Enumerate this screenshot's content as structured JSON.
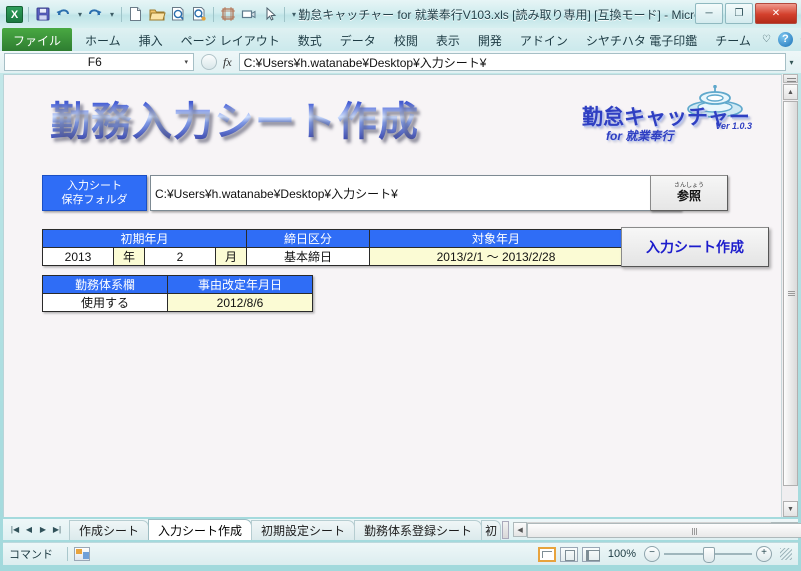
{
  "window": {
    "title": "勤怠キャッチャー for 就業奉行V103.xls [読み取り専用] [互換モード] - Micro...",
    "minimize": "─",
    "maximize": "❐",
    "close": "✕"
  },
  "quick_access": {
    "app_logo": "X",
    "items": [
      {
        "name": "save-icon",
        "label": "save"
      },
      {
        "name": "undo-icon",
        "label": "undo"
      },
      {
        "name": "undo-dropdown-icon",
        "label": "▾"
      },
      {
        "name": "redo-icon",
        "label": "redo"
      },
      {
        "name": "redo-dropdown-icon",
        "label": "▾"
      },
      {
        "name": "new-file-icon",
        "label": "new"
      },
      {
        "name": "open-folder-icon",
        "label": "open"
      },
      {
        "name": "print-preview-icon",
        "label": "print preview"
      },
      {
        "name": "quick-print-icon",
        "label": "quick print"
      },
      {
        "name": "page-setup-icon",
        "label": "page setup"
      },
      {
        "name": "camera-icon",
        "label": "camera"
      },
      {
        "name": "select-cursor-icon",
        "label": "select"
      },
      {
        "name": "customize-qat-icon",
        "label": "▾"
      }
    ]
  },
  "ribbon": {
    "tabs": [
      {
        "label": "ファイル",
        "active": true
      },
      {
        "label": "ホーム"
      },
      {
        "label": "挿入"
      },
      {
        "label": "ページ レイアウト"
      },
      {
        "label": "数式"
      },
      {
        "label": "データ"
      },
      {
        "label": "校閲"
      },
      {
        "label": "表示"
      },
      {
        "label": "開発"
      },
      {
        "label": "アドイン"
      },
      {
        "label": "シヤチハタ 電子印鑑"
      },
      {
        "label": "チーム"
      }
    ],
    "heart_icon": "♡",
    "help_icon": "?",
    "minimize_ribbon": "─",
    "restore_window": "❐",
    "close_window": "✕"
  },
  "formula_bar": {
    "name_box_value": "F6",
    "name_box_arrow": "▾",
    "fx_label": "fx",
    "formula_value": "C:¥Users¥h.watanabe¥Desktop¥入力シート¥",
    "expand_arrow": "▾"
  },
  "sheet": {
    "heading": "勤務入力シート作成",
    "logo": {
      "main": "勤怠キャッチャー",
      "sub": "for 就業奉行",
      "version": "Ver 1.0.3"
    },
    "folder": {
      "label_line1": "入力シート",
      "label_line2": "保存フォルダ",
      "path_value": "C:¥Users¥h.watanabe¥Desktop¥入力シート¥",
      "browse_button": "参照",
      "browse_button_ruby": "さんしょう"
    },
    "create_button": "入力シート作成",
    "table_period": {
      "headers": [
        "初期年月",
        "締日区分",
        "対象年月"
      ],
      "cells": {
        "year_value": "2013",
        "year_unit": "年",
        "month_value": "2",
        "month_unit": "月",
        "closing_type": "基本締日",
        "target_period": "2013/2/1  ～  2013/2/28"
      }
    },
    "table_system": {
      "headers": [
        "勤務体系欄",
        "事由改定年月日"
      ],
      "values": [
        "使用する",
        "2012/8/6"
      ]
    }
  },
  "sheet_tabs": {
    "nav": [
      "|◀",
      "◀",
      "▶",
      "▶|"
    ],
    "items": [
      {
        "label": "作成シート",
        "active": false
      },
      {
        "label": "入力シート作成",
        "active": true
      },
      {
        "label": "初期設定シート",
        "active": false
      },
      {
        "label": "勤務体系登録シート",
        "active": false
      },
      {
        "label": "初",
        "active": false
      }
    ]
  },
  "status_bar": {
    "mode_text": "コマンド",
    "macro_icon": "macro-record-icon",
    "views": [
      {
        "name": "normal-view-button",
        "selected": true
      },
      {
        "name": "page-layout-view-button",
        "selected": false
      },
      {
        "name": "page-break-view-button",
        "selected": false
      }
    ],
    "zoom_level": "100%",
    "zoom_out": "−",
    "zoom_in": "+"
  }
}
